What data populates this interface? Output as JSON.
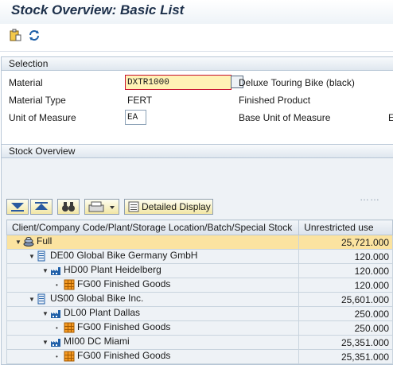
{
  "window": {
    "title": "Stock Overview: Basic List"
  },
  "toolbar": {
    "buttons": [
      {
        "icon": "clipboard-icon"
      },
      {
        "icon": "refresh-icon"
      }
    ]
  },
  "selection": {
    "header": "Selection",
    "rows": [
      {
        "label": "Material",
        "value": "DXTR1000",
        "description": "Deluxe Touring Bike (black)"
      },
      {
        "label": "Material Type",
        "value": "FERT",
        "description": "Finished Product"
      },
      {
        "label": "Unit of Measure",
        "value": "EA",
        "description": "Base Unit of Measure",
        "trailing": "E"
      }
    ]
  },
  "overview": {
    "header": "Stock Overview",
    "dots": "……",
    "alv_buttons": {
      "detailed_display": "Detailed Display"
    },
    "columns": [
      "Client/Company Code/Plant/Storage Location/Batch/Special Stock",
      "Unrestricted use"
    ],
    "rows": [
      {
        "level": 0,
        "text": "Full",
        "value": "25,721.000",
        "icon": "stack-icon"
      },
      {
        "level": 1,
        "text": "DE00 Global Bike Germany GmbH",
        "value": "120.000",
        "icon": "company-icon"
      },
      {
        "level": 2,
        "text": "HD00 Plant Heidelberg",
        "value": "120.000",
        "icon": "plant-icon"
      },
      {
        "level": 3,
        "text": "FG00 Finished Goods",
        "value": "120.000",
        "icon": "storage-icon"
      },
      {
        "level": 1,
        "text": "US00 Global Bike Inc.",
        "value": "25,601.000",
        "icon": "company-icon"
      },
      {
        "level": 2,
        "text": "DL00 Plant Dallas",
        "value": "250.000",
        "icon": "plant-icon"
      },
      {
        "level": 3,
        "text": "FG00 Finished Goods",
        "value": "250.000",
        "icon": "storage-icon"
      },
      {
        "level": 2,
        "text": "MI00 DC Miami",
        "value": "25,351.000",
        "icon": "plant-icon"
      },
      {
        "level": 3,
        "text": "FG00 Finished Goods",
        "value": "25,351.000",
        "icon": "storage-icon"
      }
    ]
  },
  "colors": {
    "highlight": "#fbe3a0",
    "border": "#b7c6d6",
    "accent": "#c8102e"
  }
}
